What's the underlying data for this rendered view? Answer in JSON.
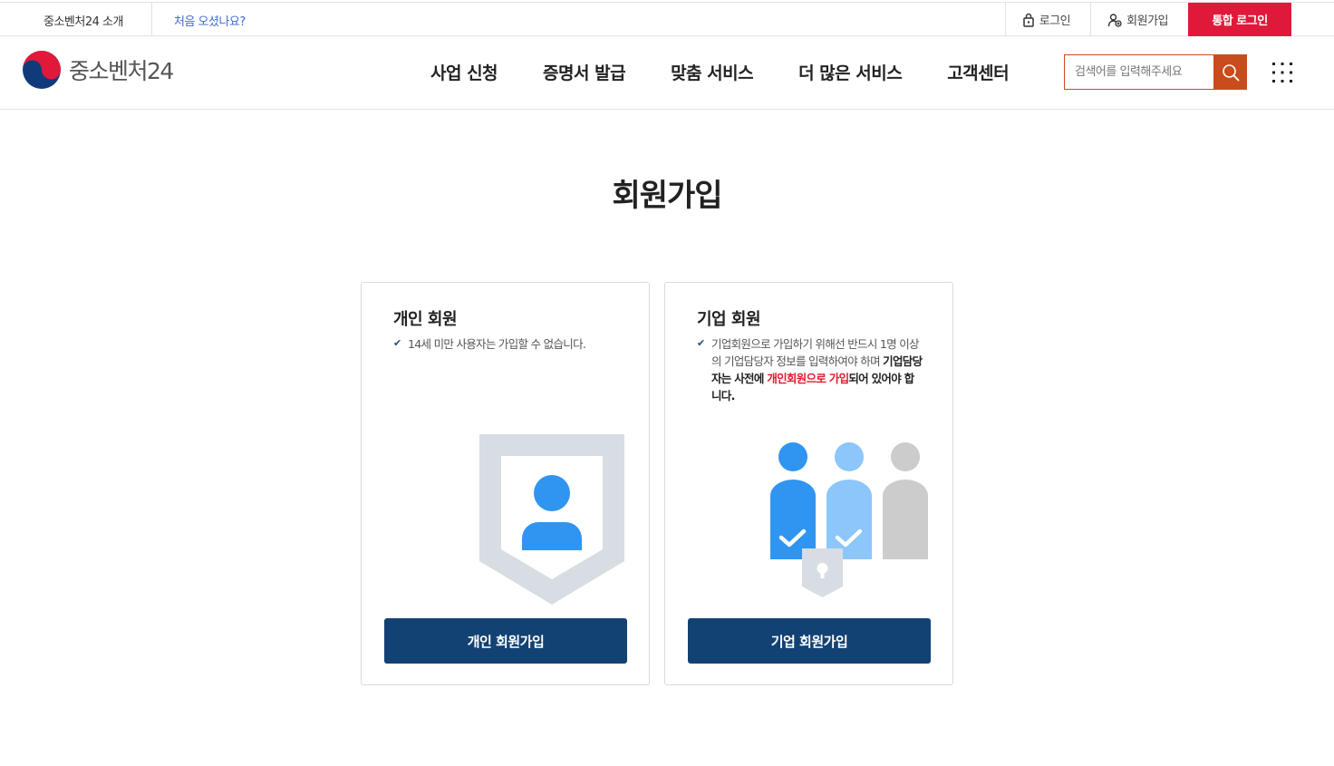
{
  "topbar": {
    "intro_link": "중소벤처24 소개",
    "first_visit_link": "처음 오셨나요?",
    "login_link": "로그인",
    "signup_link": "회원가입",
    "integrated_login": "통합 로그인"
  },
  "header": {
    "logo_text": "중소벤처24",
    "nav": [
      "사업 신청",
      "증명서 발급",
      "맞춤 서비스",
      "더 많은 서비스",
      "고객센터"
    ],
    "search_placeholder": "검색어를 입력해주세요"
  },
  "main": {
    "title": "회원가입",
    "personal": {
      "title": "개인 회원",
      "note": "14세 미만 사용자는 가입할 수 없습니다.",
      "button": "개인 회원가입"
    },
    "business": {
      "title": "기업 회원",
      "note_part1": "기업회원으로 가입하기 위해선 반드시 1명 이상의 기업담당자 정보를 입력하여야 하며 ",
      "note_bold1": "기업담당자는 사전에 ",
      "note_red": "개인회원으로 가입",
      "note_bold2": "되어 있어야 합니다.",
      "button": "기업 회원가입"
    }
  },
  "colors": {
    "brand_red": "#e0193b",
    "search_orange": "#c84c1e",
    "button_navy": "#124274",
    "illustration_blue": "#2f95f0"
  },
  "icons": [
    "lock-icon",
    "user-add-icon",
    "search-icon",
    "all-menu-icon",
    "check-icon",
    "taegeuk-logo-icon"
  ]
}
